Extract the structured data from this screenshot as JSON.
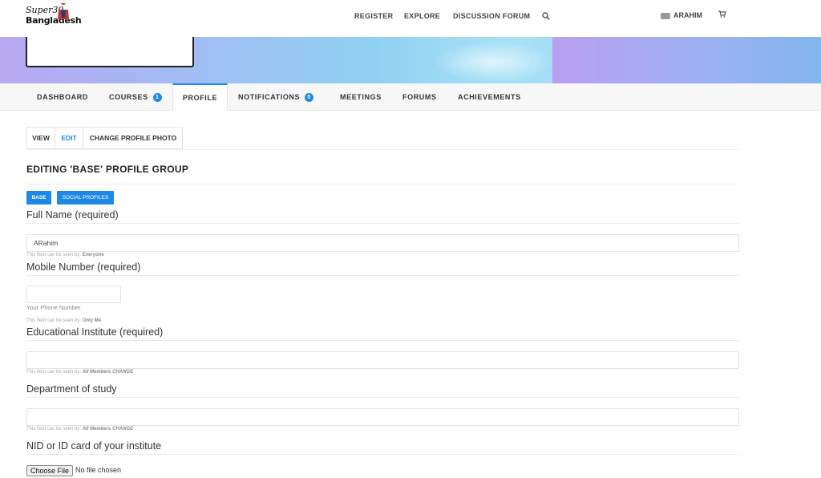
{
  "logo": {
    "line1": "Super30",
    "line2": "Bangladesh"
  },
  "topnav": {
    "items": [
      "REGISTER",
      "EXPLORE",
      "DISCUSSION FORUM"
    ],
    "user": "ARAHIM"
  },
  "tabs": {
    "dashboard": "DASHBOARD",
    "courses": "COURSES",
    "courses_count": "1",
    "profile": "PROFILE",
    "notifications": "NOTIFICATIONS",
    "notifications_count": "0",
    "meetings": "MEETINGS",
    "forums": "FORUMS",
    "achievements": "ACHIEVEMENTS"
  },
  "subtabs": {
    "view": "VIEW",
    "edit": "EDIT",
    "change_photo": "CHANGE PROFILE PHOTO"
  },
  "heading": "EDITING 'BASE' PROFILE GROUP",
  "groups": {
    "base": "BASE",
    "social": "SOCIAL PROFILES"
  },
  "fields": {
    "full_name": {
      "label": "Full Name (required)",
      "value": "ARahim",
      "vis_prefix": "This field can be seen by:",
      "vis": "Everyone"
    },
    "mobile": {
      "label": "Mobile Number (required)",
      "value": "",
      "hint": "Your Phone Number",
      "vis_prefix": "This field can be seen by:",
      "vis": "Only Me"
    },
    "institute": {
      "label": "Educational Institute (required)",
      "value": "",
      "vis_prefix": "This field can be seen by:",
      "vis": "All Members",
      "change": "CHANGE"
    },
    "department": {
      "label": "Department of study",
      "value": "",
      "vis_prefix": "This field can be seen by:",
      "vis": "All Members",
      "change": "CHANGE"
    },
    "nid": {
      "label": "NID or ID card of your institute",
      "button": "Choose File",
      "file_status": "No file chosen"
    }
  },
  "colors": {
    "accent": "#1e88e5"
  }
}
